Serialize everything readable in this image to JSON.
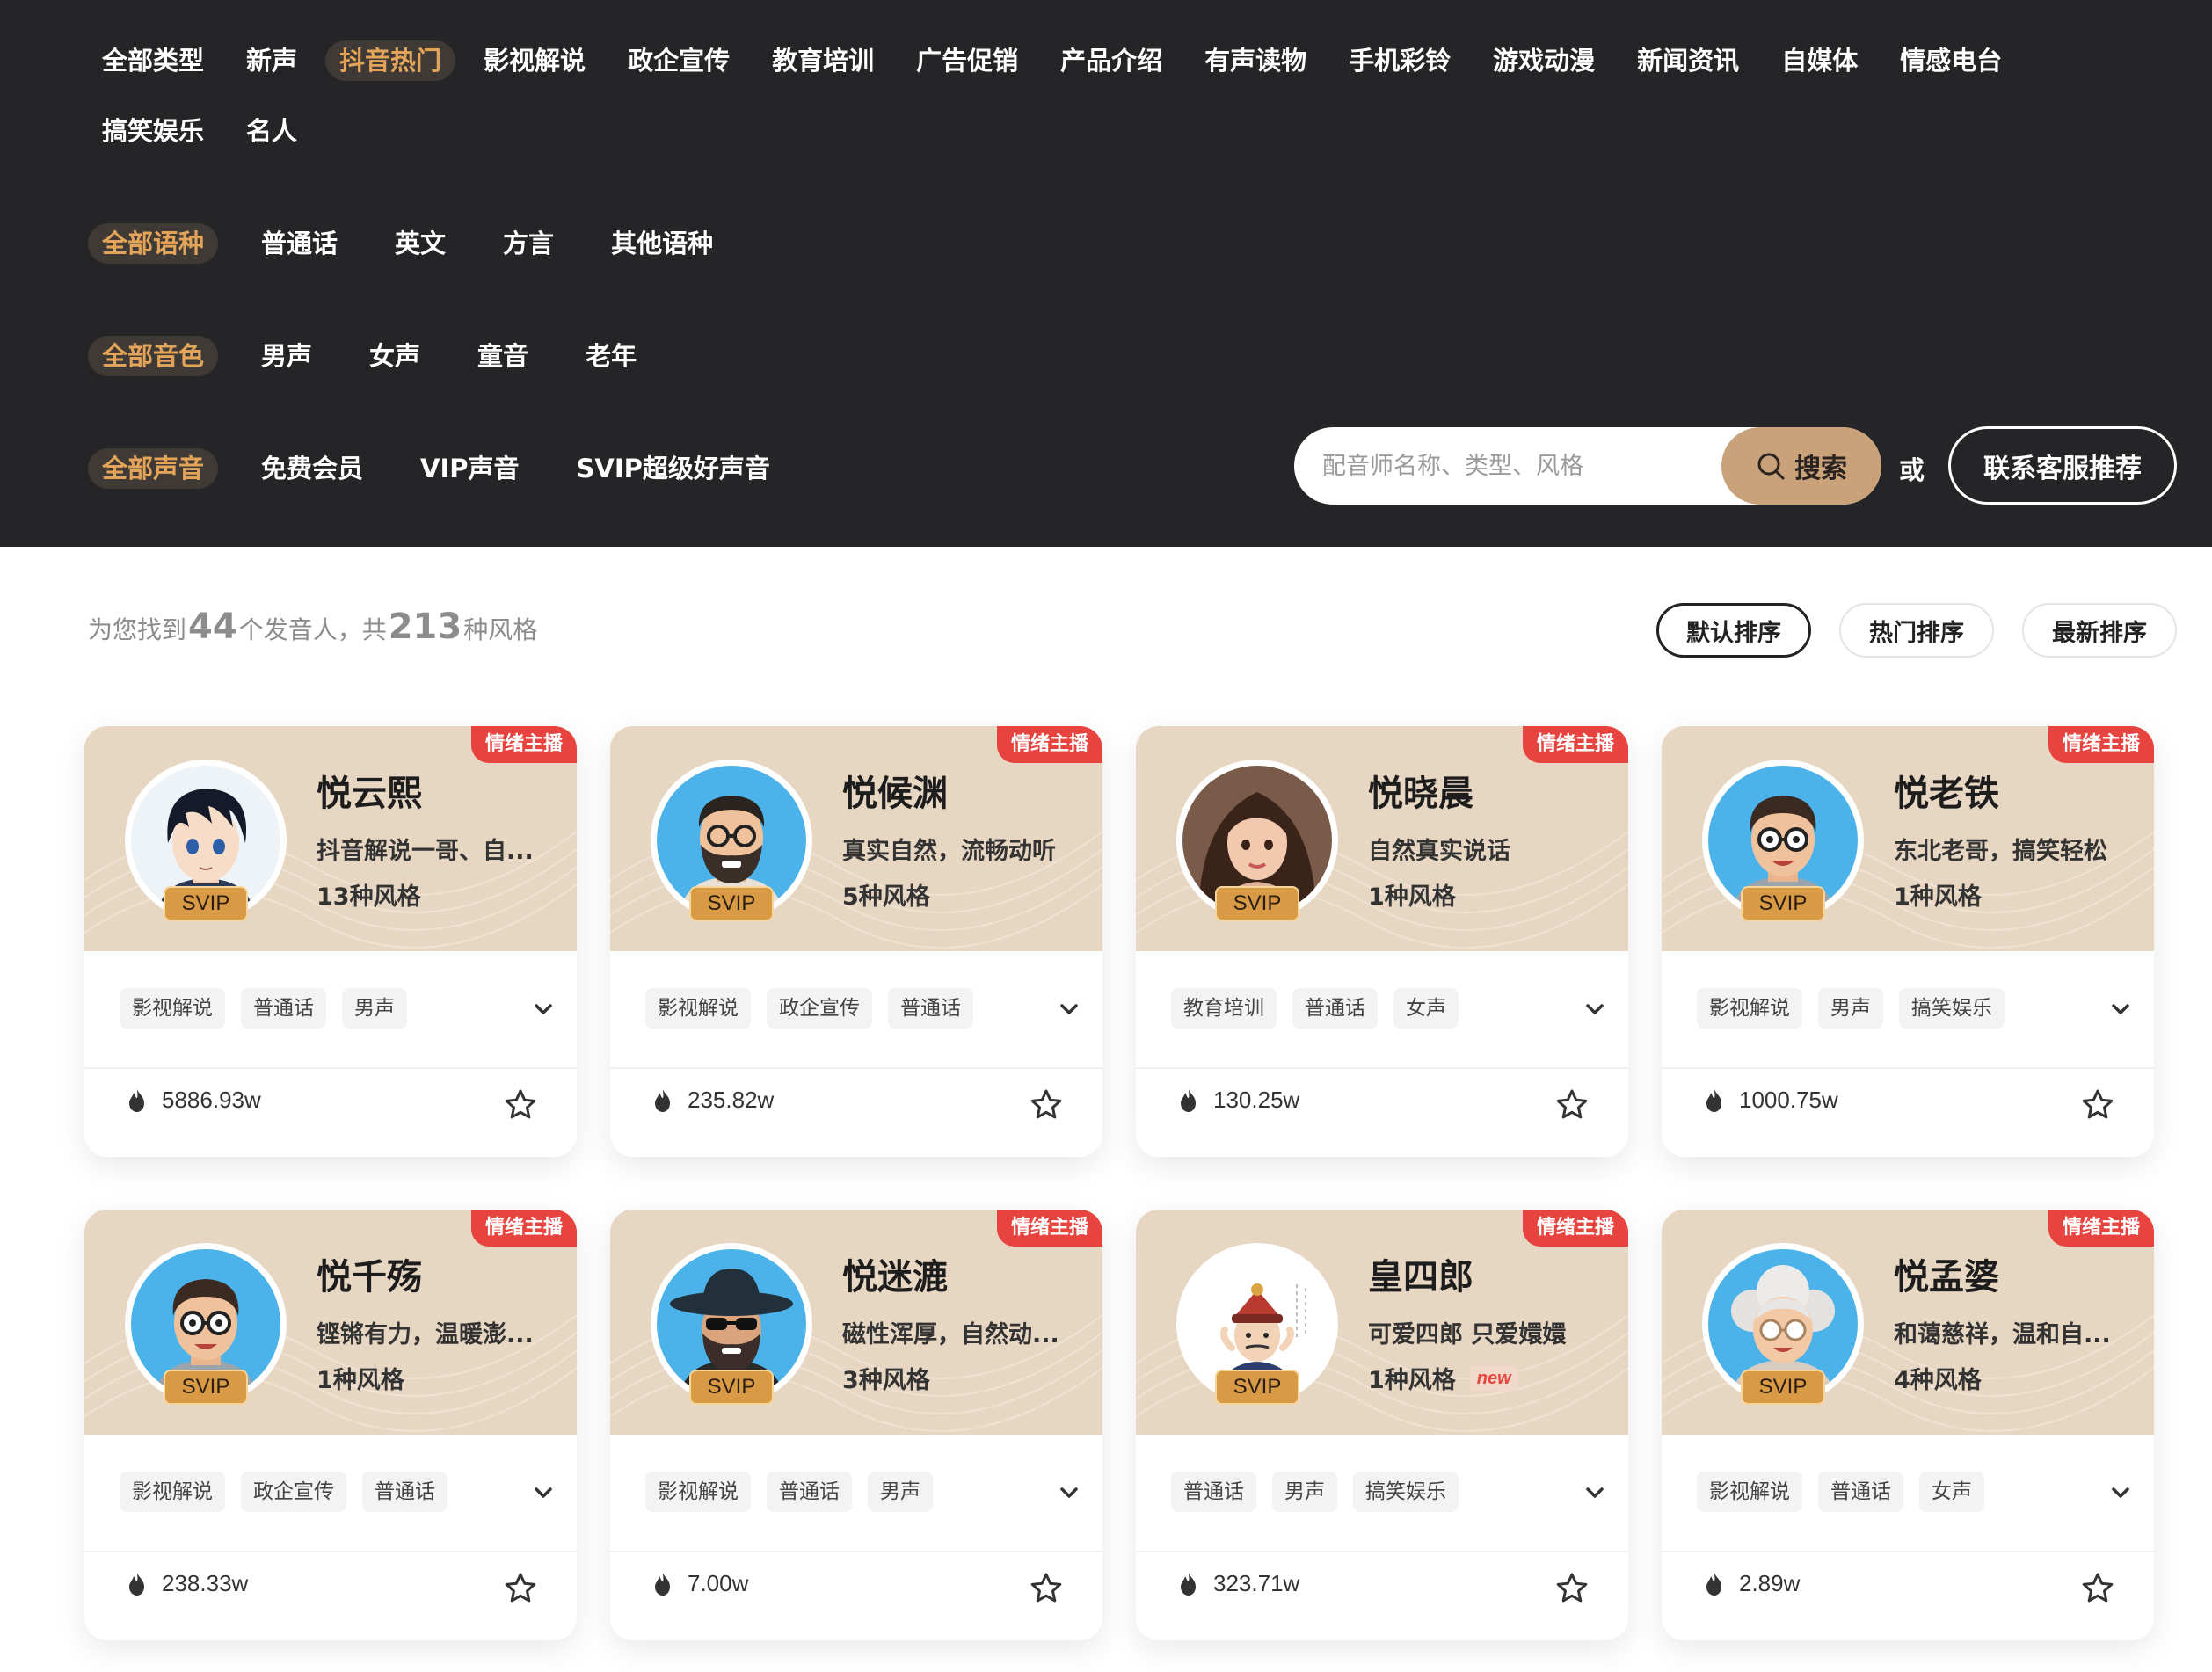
{
  "filters": {
    "types": [
      {
        "label": "全部类型",
        "active": false
      },
      {
        "label": "新声",
        "active": false
      },
      {
        "label": "抖音热门",
        "active": true
      },
      {
        "label": "影视解说",
        "active": false
      },
      {
        "label": "政企宣传",
        "active": false
      },
      {
        "label": "教育培训",
        "active": false
      },
      {
        "label": "广告促销",
        "active": false
      },
      {
        "label": "产品介绍",
        "active": false
      },
      {
        "label": "有声读物",
        "active": false
      },
      {
        "label": "手机彩铃",
        "active": false
      },
      {
        "label": "游戏动漫",
        "active": false
      },
      {
        "label": "新闻资讯",
        "active": false
      },
      {
        "label": "自媒体",
        "active": false
      },
      {
        "label": "情感电台",
        "active": false
      },
      {
        "label": "搞笑娱乐",
        "active": false
      },
      {
        "label": "名人",
        "active": false
      }
    ],
    "languages": [
      {
        "label": "全部语种",
        "active": true
      },
      {
        "label": "普通话",
        "active": false
      },
      {
        "label": "英文",
        "active": false
      },
      {
        "label": "方言",
        "active": false
      },
      {
        "label": "其他语种",
        "active": false
      }
    ],
    "tones": [
      {
        "label": "全部音色",
        "active": true
      },
      {
        "label": "男声",
        "active": false
      },
      {
        "label": "女声",
        "active": false
      },
      {
        "label": "童音",
        "active": false
      },
      {
        "label": "老年",
        "active": false
      }
    ],
    "voices": [
      {
        "label": "全部声音",
        "active": true
      },
      {
        "label": "免费会员",
        "active": false
      },
      {
        "label": "VIP声音",
        "active": false
      },
      {
        "label": "SVIP超级好声音",
        "active": false
      }
    ]
  },
  "search": {
    "placeholder": "配音师名称、类型、风格",
    "button_label": "搜索",
    "or_text": "或",
    "contact_label": "联系客服推荐"
  },
  "results": {
    "prefix": "为您找到",
    "speaker_count": "44",
    "middle": "个发音人，共",
    "style_count": "213",
    "suffix": "种风格"
  },
  "sort": {
    "default_label": "默认排序",
    "hot_label": "热门排序",
    "newest_label": "最新排序",
    "active": "default"
  },
  "colors": {
    "header_bg": "#252527",
    "accent": "#e3a45a",
    "card_top": "#e7d6c2",
    "badge_red": "#e8443f",
    "search_button": "#c9a27a"
  },
  "cards": [
    {
      "name": "悦云熙",
      "badge": "情绪主播",
      "level": "SVIP",
      "desc": "抖音解说一哥、自...",
      "styles": "13种风格",
      "is_new": false,
      "tags": [
        "影视解说",
        "普通话",
        "男声"
      ],
      "plays": "5886.93w",
      "avatar": "anime-boy-avatar"
    },
    {
      "name": "悦候渊",
      "badge": "情绪主播",
      "level": "SVIP",
      "desc": "真实自然，流畅动听",
      "styles": "5种风格",
      "is_new": false,
      "tags": [
        "影视解说",
        "政企宣传",
        "普通话"
      ],
      "plays": "235.82w",
      "avatar": "bearded-man-avatar"
    },
    {
      "name": "悦晓晨",
      "badge": "情绪主播",
      "level": "SVIP",
      "desc": "自然真实说话",
      "styles": "1种风格",
      "is_new": false,
      "tags": [
        "教育培训",
        "普通话",
        "女声"
      ],
      "plays": "130.25w",
      "avatar": "woman-avatar"
    },
    {
      "name": "悦老铁",
      "badge": "情绪主播",
      "level": "SVIP",
      "desc": "东北老哥，搞笑轻松",
      "styles": "1种风格",
      "is_new": false,
      "tags": [
        "影视解说",
        "男声",
        "搞笑娱乐"
      ],
      "plays": "1000.75w",
      "avatar": "glasses-man-avatar"
    },
    {
      "name": "悦千殇",
      "badge": "情绪主播",
      "level": "SVIP",
      "desc": "铿锵有力，温暖澎...",
      "styles": "1种风格",
      "is_new": false,
      "tags": [
        "影视解说",
        "政企宣传",
        "普通话"
      ],
      "plays": "238.33w",
      "avatar": "glasses-man-avatar"
    },
    {
      "name": "悦迷漉",
      "badge": "情绪主播",
      "level": "SVIP",
      "desc": "磁性浑厚，自然动...",
      "styles": "3种风格",
      "is_new": false,
      "tags": [
        "影视解说",
        "普通话",
        "男声"
      ],
      "plays": "7.00w",
      "avatar": "hat-man-avatar"
    },
    {
      "name": "皇四郎",
      "badge": "情绪主播",
      "level": "SVIP",
      "desc": "可爱四郎 只爱嬛嬛",
      "styles": "1种风格",
      "is_new": true,
      "new_label": "new",
      "tags": [
        "普通话",
        "男声",
        "搞笑娱乐"
      ],
      "plays": "323.71w",
      "avatar": "emperor-avatar"
    },
    {
      "name": "悦孟婆",
      "badge": "情绪主播",
      "level": "SVIP",
      "desc": "和蔼慈祥，温和自...",
      "styles": "4种风格",
      "is_new": false,
      "tags": [
        "影视解说",
        "普通话",
        "女声"
      ],
      "plays": "2.89w",
      "avatar": "grandma-avatar"
    }
  ]
}
